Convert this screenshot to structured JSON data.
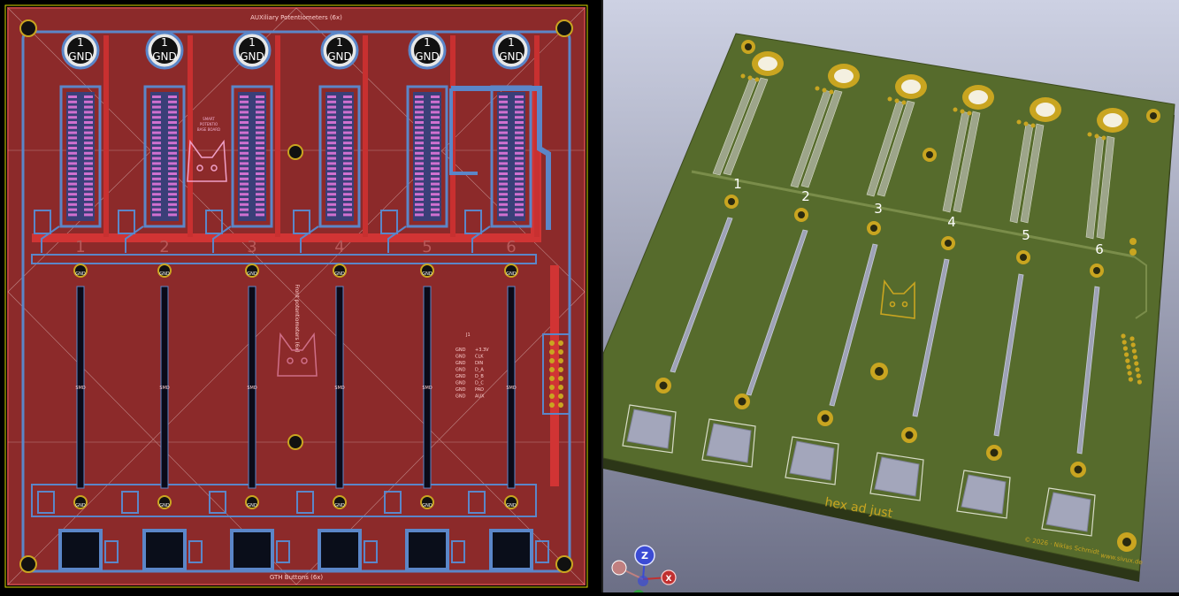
{
  "left_view": {
    "title_top": "AUXiliary Potentiometers (6x)",
    "title_bottom": "GTH Buttons (6x)",
    "middle_vertical_label": "Front potentiometers (6x)",
    "pad_label_gnd": "GND",
    "pad_label_one": "1",
    "channel_numbers": [
      "1",
      "2",
      "3",
      "4",
      "5",
      "6"
    ],
    "mark_label": "SMD",
    "connector_pins": [
      "+3.3V",
      "CLK",
      "DIN",
      "D_A",
      "D_B",
      "D_C",
      "PAD",
      "AUX"
    ],
    "connector_gnds": [
      "GND",
      "GND",
      "GND",
      "GND",
      "GND",
      "GND",
      "GND",
      "GND"
    ],
    "connector_ref": "J1",
    "logo_text": [
      "SMART",
      "POTENTIO",
      "BASE BOARD"
    ]
  },
  "right_view": {
    "channel_numbers": [
      "1",
      "2",
      "3",
      "4",
      "5",
      "6"
    ],
    "brand": "hex ad just",
    "copyright": "© 2026 · Niklas Schmidt",
    "website": "www.sivux.de"
  },
  "axes_gizmo": {
    "z": "Z",
    "x": "X"
  },
  "colors": {
    "board_red": "#8c2a2a",
    "copper_blue": "#5b86c8",
    "pcb_green": "#566b2c",
    "gold": "#c9a520",
    "bg_3d_top": "#cdd1e3",
    "bg_3d_bottom": "#6c6f86"
  }
}
